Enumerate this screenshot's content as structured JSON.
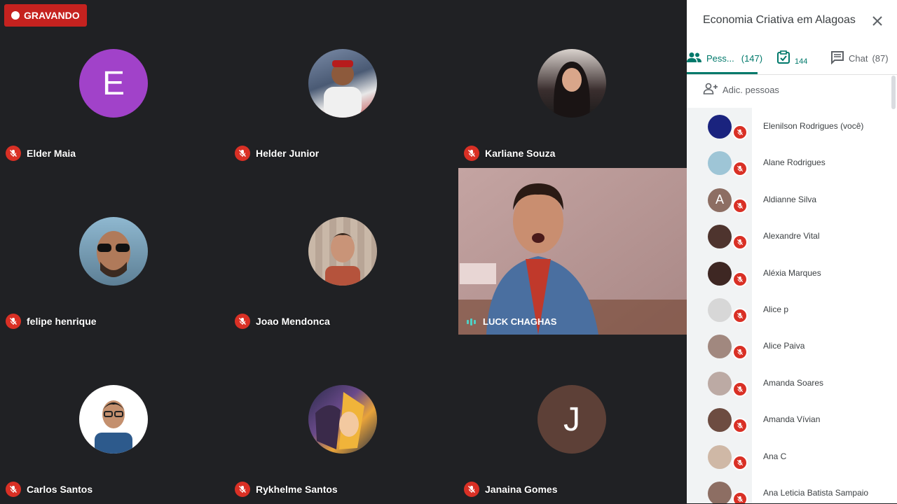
{
  "recording": {
    "label": "GRAVANDO"
  },
  "grid": {
    "tiles": [
      {
        "name": "Elder Maia",
        "avatar_letter": "E",
        "avatar_color": "#a142c9"
      },
      {
        "name": "Helder Junior",
        "avatar_color": "#5c6f8c"
      },
      {
        "name": "Karliane Souza",
        "avatar_color": "#3a2e2e"
      },
      {
        "name": "felipe henrique",
        "avatar_color": "#4b6f86"
      },
      {
        "name": "Joao Mendonca",
        "avatar_color": "#8a6a5a"
      },
      {
        "name": "Carlos Santos",
        "avatar_color": "#2d5a8c"
      },
      {
        "name": "Rykhelme Santos",
        "avatar_color": "#c7892f"
      },
      {
        "name": "Janaina Gomes",
        "avatar_letter": "J",
        "avatar_color": "#5d4037"
      }
    ],
    "video": {
      "name": "LUCK CHAGHAS"
    }
  },
  "panel": {
    "title": "Economia Criativa em Alagoas",
    "tabs": [
      {
        "label": "Pess...",
        "count": "(147)",
        "icon": "people-icon"
      },
      {
        "label": "",
        "count": "144",
        "icon": "task-check-icon"
      },
      {
        "label": "Chat",
        "count": "(87)",
        "icon": "chat-icon"
      }
    ],
    "add_people": "Adic. pessoas",
    "people": [
      {
        "name": "Elenilson Rodrigues (você)",
        "color": "#1a237e"
      },
      {
        "name": "Alane Rodrigues",
        "color": "#9ec5d6"
      },
      {
        "name": "Aldianne Silva",
        "letter": "A",
        "color": "#8d6e63"
      },
      {
        "name": "Alexandre Vital",
        "color": "#4e342e"
      },
      {
        "name": "Aléxia Marques",
        "color": "#3e2723"
      },
      {
        "name": "Alice p",
        "color": "#d7d7d7"
      },
      {
        "name": "Alice Paiva",
        "color": "#a1887f"
      },
      {
        "name": "Amanda Soares",
        "color": "#bcaaa4"
      },
      {
        "name": "Amanda Vívian",
        "color": "#6d4c41"
      },
      {
        "name": "Ana C",
        "color": "#cfb8a6"
      },
      {
        "name": "Ana Leticia Batista Sampaio",
        "color": "#8d6e63"
      }
    ]
  }
}
